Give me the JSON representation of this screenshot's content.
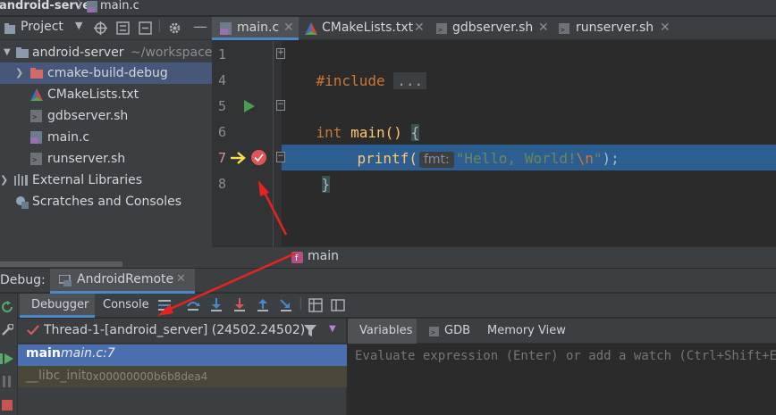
{
  "breadcrumb": {
    "project": "android-server",
    "file": "main.c"
  },
  "project_panel": {
    "title": "Project",
    "tree": [
      {
        "label": "android-server",
        "suffix": "~/workspace/c",
        "kind": "folder",
        "expanded": true
      },
      {
        "label": "cmake-build-debug",
        "kind": "folder-red",
        "selected": true
      },
      {
        "label": "CMakeLists.txt",
        "kind": "cmake"
      },
      {
        "label": "gdbserver.sh",
        "kind": "shell"
      },
      {
        "label": "main.c",
        "kind": "c"
      },
      {
        "label": "runserver.sh",
        "kind": "shell"
      },
      {
        "label": "External Libraries",
        "kind": "libs"
      },
      {
        "label": "Scratches and Consoles",
        "kind": "scratch"
      }
    ]
  },
  "editor": {
    "tabs": [
      {
        "label": "main.c",
        "icon": "c-file-icon",
        "active": true
      },
      {
        "label": "CMakeLists.txt",
        "icon": "cmake-icon",
        "active": false
      },
      {
        "label": "gdbserver.sh",
        "icon": "shell-icon",
        "active": false
      },
      {
        "label": "runserver.sh",
        "icon": "shell-icon",
        "active": false
      }
    ],
    "line_numbers": [
      "1",
      "4",
      "5",
      "6",
      "7",
      "8"
    ],
    "code": {
      "l1_kw": "#include",
      "l1_fold": "...",
      "l5_type": "int",
      "l5_name": " main() ",
      "l5_brace": "{",
      "l6_fn": "printf(",
      "l6_hint": "fmt:",
      "l6_str": "\"Hello, World!",
      "l6_esc": "\\n",
      "l6_end_str": "\"",
      "l6_tail": ");",
      "l7": "}"
    },
    "breadcrumb_function": "main"
  },
  "debug": {
    "label": "Debug:",
    "config": "AndroidRemote",
    "tabs": {
      "debugger": "Debugger",
      "console": "Console"
    },
    "thread": "Thread-1-[android_server] (24502.24502)",
    "frames": [
      {
        "name": "main",
        "location": "main.c:7"
      },
      {
        "name": "__libc_init",
        "location": "0x00000000b6b8dea4"
      }
    ],
    "var_tabs": {
      "variables": "Variables",
      "gdb": "GDB",
      "memory": "Memory View"
    },
    "watch_placeholder": "Evaluate expression (Enter) or add a watch (Ctrl+Shift+Ente"
  },
  "colors": {
    "accent": "#4a88c7",
    "exec_line": "#2d5e91",
    "keyword": "#cc7832",
    "string": "#6a8759",
    "function": "#ffc66d",
    "breakpoint": "#e05555",
    "arrow_annotation": "#e8231f"
  }
}
